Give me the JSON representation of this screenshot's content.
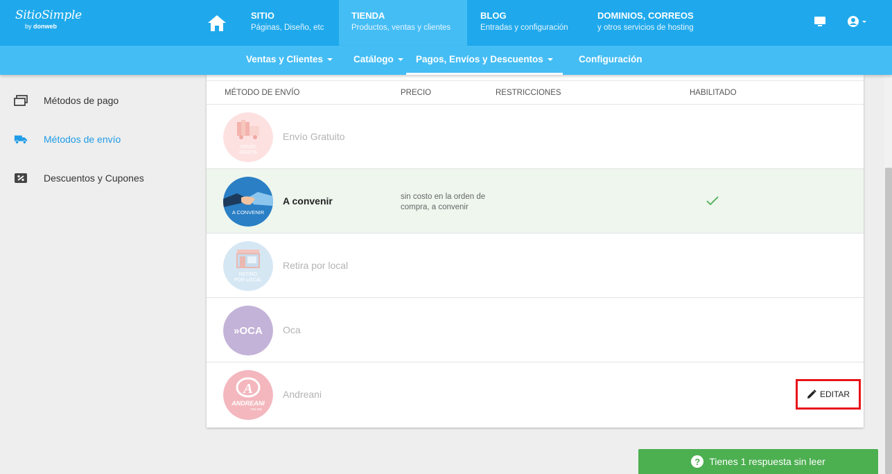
{
  "header": {
    "logo_brand": "SitioSimple",
    "logo_by": "by",
    "logo_company": "donweb",
    "home_icon": "home-icon",
    "tabs": [
      {
        "title": "SITIO",
        "subtitle": "Páginas, Diseño, etc",
        "active": false
      },
      {
        "title": "TIENDA",
        "subtitle": "Productos, ventas y clientes",
        "active": true
      },
      {
        "title": "BLOG",
        "subtitle": "Entradas y configuración",
        "active": false
      },
      {
        "title": "DOMINIOS, CORREOS",
        "subtitle": "y otros servicios de hosting",
        "active": false
      }
    ],
    "right_icons": [
      "monitor-icon",
      "account-icon"
    ]
  },
  "subnav": {
    "items": [
      {
        "label": "Ventas y Clientes",
        "dropdown": true
      },
      {
        "label": "Catálogo",
        "dropdown": true
      },
      {
        "label": "Pagos, Envíos y Descuentos",
        "dropdown": true,
        "active": true
      },
      {
        "label": "Configuración",
        "dropdown": false
      }
    ]
  },
  "sidebar": {
    "items": [
      {
        "label": "Métodos de pago",
        "icon": "payment-card-icon",
        "active": false
      },
      {
        "label": "Métodos de envío",
        "icon": "truck-icon",
        "active": true
      },
      {
        "label": "Descuentos y Cupones",
        "icon": "discount-icon",
        "active": false
      }
    ]
  },
  "table": {
    "columns": [
      "MÉTODO DE ENVÍO",
      "PRECIO",
      "RESTRICCIONES",
      "HABILITADO"
    ],
    "rows": [
      {
        "name": "Envío Gratuito",
        "badge_line1": "ENVÍO",
        "badge_line2": "GRATIS",
        "price": "",
        "enabled": false,
        "color": "#fde1e1"
      },
      {
        "name": "A convenir",
        "badge_line1": "A CONVENIR",
        "badge_line2": "",
        "price": "sin costo en la orden de compra, a convenir",
        "enabled": true,
        "color": "#2a7fc5"
      },
      {
        "name": "Retira por local",
        "badge_line1": "RETIRO",
        "badge_line2": "POR LOCAL",
        "price": "",
        "enabled": false,
        "color": "#d6e7f4"
      },
      {
        "name": "Oca",
        "badge_line1": "»OCA",
        "badge_line2": "",
        "price": "",
        "enabled": false,
        "color": "#c3b3d8"
      },
      {
        "name": "Andreani",
        "badge_line1": "ANDREANI",
        "badge_line2": "ONLINE",
        "price": "",
        "enabled": false,
        "color": "#f3b7bd"
      }
    ],
    "edit_label": "EDITAR"
  },
  "chat": {
    "label": "Tienes 1 respuesta sin leer",
    "icon_glyph": "?"
  },
  "colors": {
    "primary": "#1fa9ec",
    "primary_light": "#44bdf5",
    "enabled_row": "#eef6ee",
    "check": "#4caf50",
    "highlight": "#e8141a",
    "chat": "#4caf50"
  }
}
